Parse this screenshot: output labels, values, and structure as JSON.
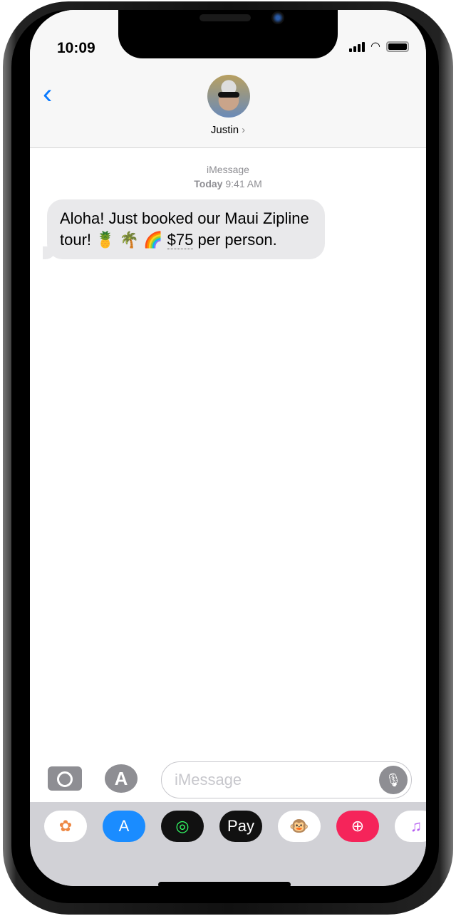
{
  "status_bar": {
    "time": "10:09"
  },
  "header": {
    "back_icon": "chevron-left-icon",
    "contact_name": "Justin",
    "chevron": "›"
  },
  "conversation": {
    "service": "iMessage",
    "date_label": "Today",
    "time": "9:41 AM",
    "messages": [
      {
        "text_before": "Aloha! Just booked our Maui Zipline tour! 🍍 🌴 🌈 ",
        "amount": "$75",
        "text_after": " per person.",
        "direction": "incoming"
      }
    ]
  },
  "input": {
    "placeholder": "iMessage",
    "value": ""
  },
  "app_drawer": [
    {
      "name": "photos",
      "bg": "#ffffff",
      "glyph": "✿",
      "color": "#e84"
    },
    {
      "name": "app-store",
      "bg": "#1a8cff",
      "glyph": "A",
      "color": "#fff"
    },
    {
      "name": "activity",
      "bg": "#111111",
      "glyph": "◎",
      "color": "#3f6"
    },
    {
      "name": "apple-pay",
      "bg": "#111111",
      "glyph": " Pay",
      "color": "#fff"
    },
    {
      "name": "animoji",
      "bg": "#ffffff",
      "glyph": "🐵",
      "color": "#000"
    },
    {
      "name": "images-search",
      "bg": "#f5245a",
      "glyph": "⊕",
      "color": "#fff"
    },
    {
      "name": "music",
      "bg": "#ffffff",
      "glyph": "♫",
      "color": "#b45cf0"
    }
  ],
  "colors": {
    "accent": "#0a7aff",
    "bubble": "#e9e9eb",
    "drawer": "#d1d1d6"
  }
}
